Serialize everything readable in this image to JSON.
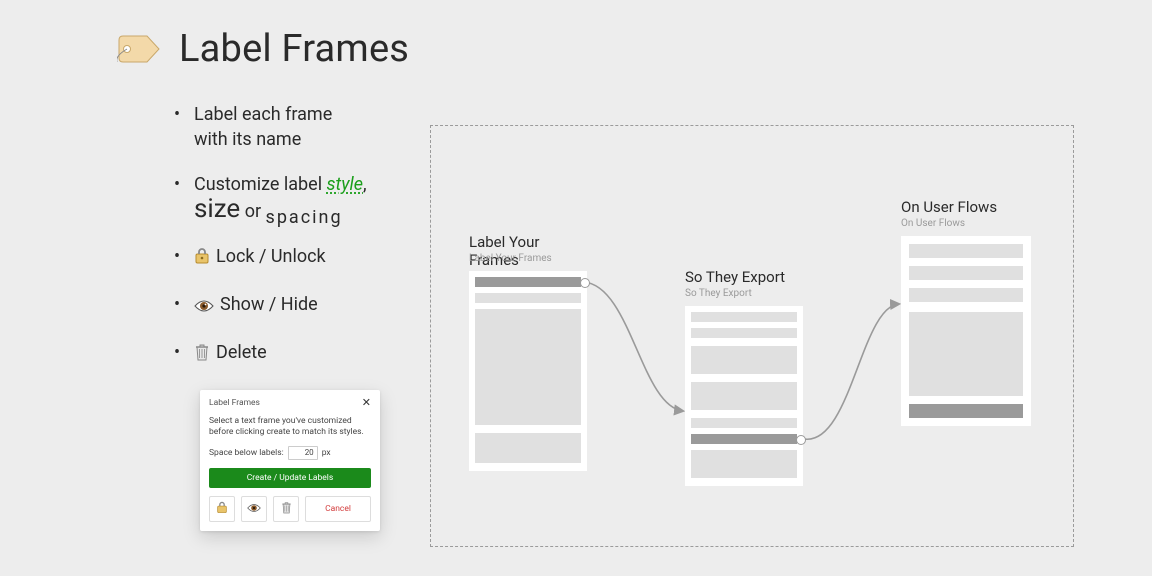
{
  "title": "Label Frames",
  "bullets": {
    "b1a": "Label each frame",
    "b1b": "with its name",
    "b2a": "Customize label ",
    "b2_style": "style",
    "b2b": ",",
    "b2_size": "size",
    "b2c": " or ",
    "b2_spacing": "spacing",
    "b3": "Lock / Unlock",
    "b4": "Show / Hide",
    "b5": "Delete"
  },
  "dialog": {
    "title": "Label Frames",
    "body": "Select a text frame you've customized before clicking create to match its styles.",
    "space_label": "Space below labels:",
    "space_value": "20",
    "space_unit": "px",
    "primary": "Create / Update Labels",
    "cancel": "Cancel"
  },
  "frames": {
    "f1_title": "Label Your Frames",
    "f1_sub": "Label Your Frames",
    "f2_title": "So They Export",
    "f2_sub": "So They Export",
    "f3_title": "On User Flows",
    "f3_sub": "On User Flows"
  }
}
